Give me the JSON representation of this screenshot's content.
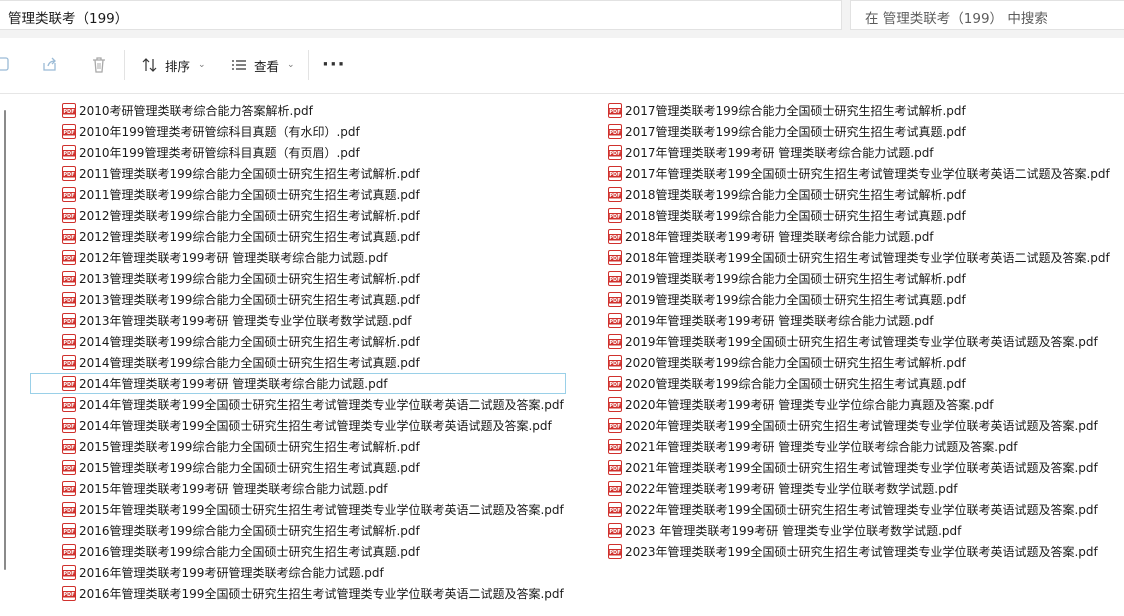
{
  "window": {
    "breadcrumb": "管理类联考（199）",
    "search_placeholder": "在 管理类联考（199） 中搜索"
  },
  "toolbar": {
    "sort_label": "排序",
    "view_label": "查看",
    "more_label": "···"
  },
  "colors": {
    "pdf_red": "#d0312d",
    "selection_border": "#9ad0e8"
  },
  "files": {
    "selected_index": 13,
    "items": [
      "2010考研管理类联考综合能力答案解析.pdf",
      "2010年199管理类考研管综科目真题（有水印）.pdf",
      "2010年199管理类考研管综科目真题（有页眉）.pdf",
      "2011管理类联考199综合能力全国硕士研究生招生考试解析.pdf",
      "2011管理类联考199综合能力全国硕士研究生招生考试真题.pdf",
      "2012管理类联考199综合能力全国硕士研究生招生考试解析.pdf",
      "2012管理类联考199综合能力全国硕士研究生招生考试真题.pdf",
      "2012年管理类联考199考研 管理类联考综合能力试题.pdf",
      "2013管理类联考199综合能力全国硕士研究生招生考试解析.pdf",
      "2013管理类联考199综合能力全国硕士研究生招生考试真题.pdf",
      "2013年管理类联考199考研 管理类专业学位联考数学试题.pdf",
      "2014管理类联考199综合能力全国硕士研究生招生考试解析.pdf",
      "2014管理类联考199综合能力全国硕士研究生招生考试真题.pdf",
      "2014年管理类联考199考研 管理类联考综合能力试题.pdf",
      "2014年管理类联考199全国硕士研究生招生考试管理类专业学位联考英语二试题及答案.pdf",
      "2014年管理类联考199全国硕士研究生招生考试管理类专业学位联考英语试题及答案.pdf",
      "2015管理类联考199综合能力全国硕士研究生招生考试解析.pdf",
      "2015管理类联考199综合能力全国硕士研究生招生考试真题.pdf",
      "2015年管理类联考199考研 管理类联考综合能力试题.pdf",
      "2015年管理类联考199全国硕士研究生招生考试管理类专业学位联考英语二试题及答案.pdf",
      "2016管理类联考199综合能力全国硕士研究生招生考试解析.pdf",
      "2016管理类联考199综合能力全国硕士研究生招生考试真题.pdf",
      "2016年管理类联考199考研管理类联考综合能力试题.pdf",
      "2016年管理类联考199全国硕士研究生招生考试管理类专业学位联考英语二试题及答案.pdf",
      "2017管理类联考199综合能力全国硕士研究生招生考试解析.pdf",
      "2017管理类联考199综合能力全国硕士研究生招生考试真题.pdf",
      "2017年管理类联考199考研 管理类联考综合能力试题.pdf",
      "2017年管理类联考199全国硕士研究生招生考试管理类专业学位联考英语二试题及答案.pdf",
      "2018管理类联考199综合能力全国硕士研究生招生考试解析.pdf",
      "2018管理类联考199综合能力全国硕士研究生招生考试真题.pdf",
      "2018年管理类联考199考研 管理类联考综合能力试题.pdf",
      "2018年管理类联考199全国硕士研究生招生考试管理类专业学位联考英语二试题及答案.pdf",
      "2019管理类联考199综合能力全国硕士研究生招生考试解析.pdf",
      "2019管理类联考199综合能力全国硕士研究生招生考试真题.pdf",
      "2019年管理类联考199考研 管理类联考综合能力试题.pdf",
      "2019年管理类联考199全国硕士研究生招生考试管理类专业学位联考英语试题及答案.pdf",
      "2020管理类联考199综合能力全国硕士研究生招生考试解析.pdf",
      "2020管理类联考199综合能力全国硕士研究生招生考试真题.pdf",
      "2020年管理类联考199考研 管理类专业学位综合能力真题及答案.pdf",
      "2020年管理类联考199全国硕士研究生招生考试管理类专业学位联考英语试题及答案.pdf",
      "2021年管理类联考199考研 管理类专业学位联考综合能力试题及答案.pdf",
      "2021年管理类联考199全国硕士研究生招生考试管理类专业学位联考英语试题及答案.pdf",
      "2022年管理类联考199考研 管理类专业学位联考数学试题.pdf",
      "2022年管理类联考199全国硕士研究生招生考试管理类专业学位联考英语试题及答案.pdf",
      "2023 年管理类联考199考研 管理类专业学位联考数学试题.pdf",
      "2023年管理类联考199全国硕士研究生招生考试管理类专业学位联考英语试题及答案.pdf"
    ]
  }
}
